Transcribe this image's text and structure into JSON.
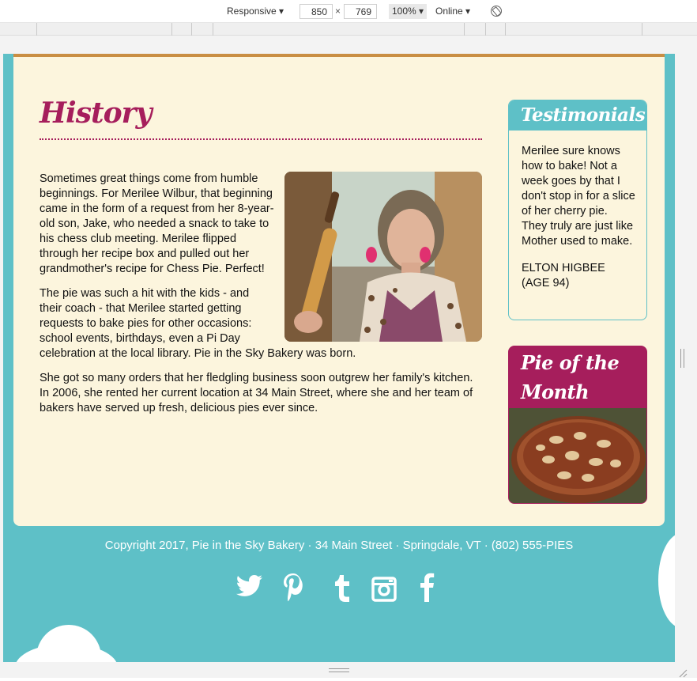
{
  "devtools": {
    "device": "Responsive ▾",
    "width": "850",
    "times": "×",
    "height": "769",
    "zoom": "100% ▾",
    "network": "Online ▾",
    "rotate_icon": "rotate-icon"
  },
  "history": {
    "title": "History",
    "p1": "Sometimes great things come from humble beginnings. For Merilee Wilbur, that beginning came in the form of a request from her 8-year-old son, Jake, who needed a snack to take to his chess club meeting. Merilee flipped through her recipe box and pulled out her grandmother's recipe for Chess Pie. Perfect!",
    "p2_part1": "The pie was such a hit with the kids - and their coach - that Merilee started getting requests to bake pies for other occasions: school events, birthdays, even a Pi Day",
    "p2_part2": "celebration at the local library. Pie in the Sky Bakery was born.",
    "p3": "She got so many orders that her fledgling business soon outgrew her family's kitchen. In 2006, she rented her current location at 34 Main Street, where she and her team of bakers have served up fresh, delicious pies ever since."
  },
  "testimonials": {
    "title": "Testimonials",
    "quote": "Merilee sure knows how to bake! Not a week goes by that I don't stop in for a slice of her cherry pie. They truly are just like Mother used to make.",
    "author_line1": "ELTON HIGBEE",
    "author_line2": "(AGE 94)"
  },
  "pie_of_month": {
    "title_line1": "Pie of the",
    "title_line2": "Month"
  },
  "footer": {
    "copyright": "Copyright 2017, Pie in the Sky Bakery · 34 Main Street · Springdale, VT · (802) 555-PIES",
    "social": [
      "twitter-icon",
      "pinterest-icon",
      "tumblr-icon",
      "instagram-icon",
      "facebook-icon"
    ]
  },
  "colors": {
    "teal": "#5ec0c7",
    "cream": "#fcf5dd",
    "magenta": "#a61e5c",
    "accent_border": "#c98e43"
  }
}
